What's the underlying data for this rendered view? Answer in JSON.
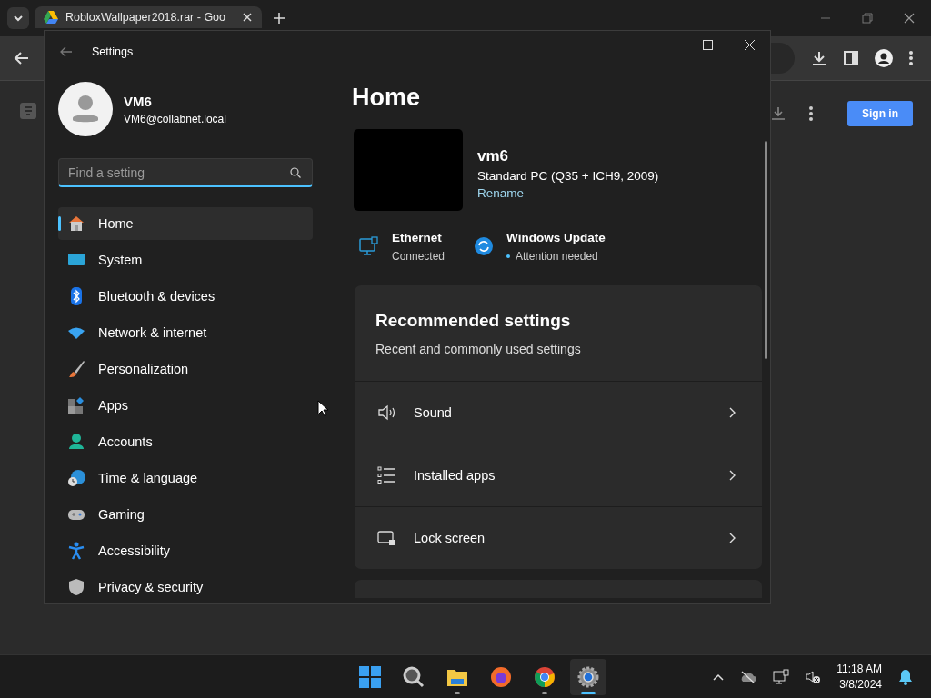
{
  "browser": {
    "tab_title": "RobloxWallpaper2018.rar - Goo",
    "sign_in": "Sign in"
  },
  "window": {
    "title": "Settings"
  },
  "account": {
    "name": "VM6",
    "email": "VM6@collabnet.local"
  },
  "search": {
    "placeholder": "Find a setting"
  },
  "sidebar": {
    "items": [
      {
        "label": "Home",
        "selected": true
      },
      {
        "label": "System",
        "selected": false
      },
      {
        "label": "Bluetooth & devices",
        "selected": false
      },
      {
        "label": "Network & internet",
        "selected": false
      },
      {
        "label": "Personalization",
        "selected": false
      },
      {
        "label": "Apps",
        "selected": false
      },
      {
        "label": "Accounts",
        "selected": false
      },
      {
        "label": "Time & language",
        "selected": false
      },
      {
        "label": "Gaming",
        "selected": false
      },
      {
        "label": "Accessibility",
        "selected": false
      },
      {
        "label": "Privacy & security",
        "selected": false
      }
    ]
  },
  "page": {
    "title": "Home"
  },
  "device": {
    "name": "vm6",
    "model": "Standard PC (Q35 + ICH9, 2009)",
    "rename": "Rename"
  },
  "status": [
    {
      "title": "Ethernet",
      "detail": "Connected",
      "alert": false
    },
    {
      "title": "Windows Update",
      "detail": "Attention needed",
      "alert": true
    }
  ],
  "recommended": {
    "title": "Recommended settings",
    "subtitle": "Recent and commonly used settings",
    "rows": [
      {
        "label": "Sound"
      },
      {
        "label": "Installed apps"
      },
      {
        "label": "Lock screen"
      }
    ]
  },
  "taskbar": {
    "apps": [
      {
        "running": true,
        "selected": false
      },
      {
        "running": false,
        "selected": false
      },
      {
        "running": true,
        "selected": false
      },
      {
        "running": true,
        "selected": true
      }
    ],
    "time": "11:18 AM",
    "date": "3/8/2024"
  }
}
